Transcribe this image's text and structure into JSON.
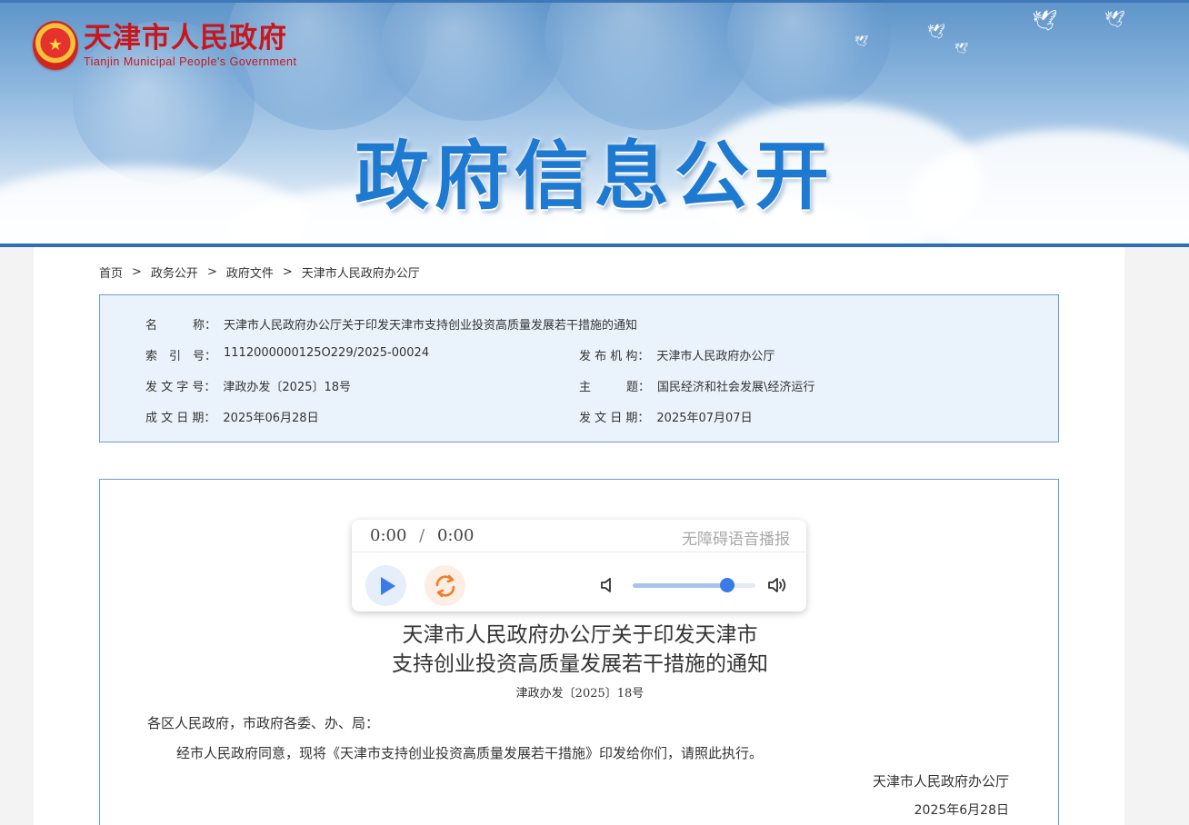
{
  "header": {
    "site_name_cn": "天津市人民政府",
    "site_name_en": "Tianjin Municipal People's Government",
    "banner_title": "政府信息公开"
  },
  "breadcrumb": {
    "items": [
      "首页",
      "政务公开",
      "政府文件",
      "天津市人民政府办公厅"
    ],
    "separator": ">"
  },
  "meta": {
    "name_label": "名　　　称：",
    "name_value": "天津市人民政府办公厅关于印发天津市支持创业投资高质量发展若干措施的通知",
    "index_label": "索　引　号：",
    "index_value": "1112000000125O229/2025-00024",
    "issuer_label": "发 布 机 构：",
    "issuer_value": "天津市人民政府办公厅",
    "docno_label": "发 文 字 号：",
    "docno_value": "津政办发〔2025〕18号",
    "topic_label": "主　　　题：",
    "topic_value": "国民经济和社会发展\\经济运行",
    "created_label": "成 文 日 期：",
    "created_value": "2025年06月28日",
    "published_label": "发 文 日 期：",
    "published_value": "2025年07月07日"
  },
  "player": {
    "current_time": "0:00",
    "separator": "/",
    "duration": "0:00",
    "label": "无障碍语音播报",
    "volume_fraction": 0.77,
    "play_icon": "play-icon",
    "replay_icon": "replay-icon"
  },
  "document": {
    "title_line1": "天津市人民政府办公厅关于印发天津市",
    "title_line2": "支持创业投资高质量发展若干措施的通知",
    "doc_number": "津政办发〔2025〕18号",
    "salutation": "各区人民政府，市政府各委、办、局：",
    "paragraph": "经市人民政府同意，现将《天津市支持创业投资高质量发展若干措施》印发给你们，请照此执行。",
    "signature_org": "天津市人民政府办公厅",
    "signature_date": "2025年6月28日"
  },
  "colors": {
    "brand_red": "#c8161d",
    "banner_blue": "#1e7ad0",
    "border_blue": "#6d9ccf",
    "meta_bg": "#eaf3fc",
    "accent_blue": "#3a7be6",
    "replay_orange": "#f07d2a"
  }
}
